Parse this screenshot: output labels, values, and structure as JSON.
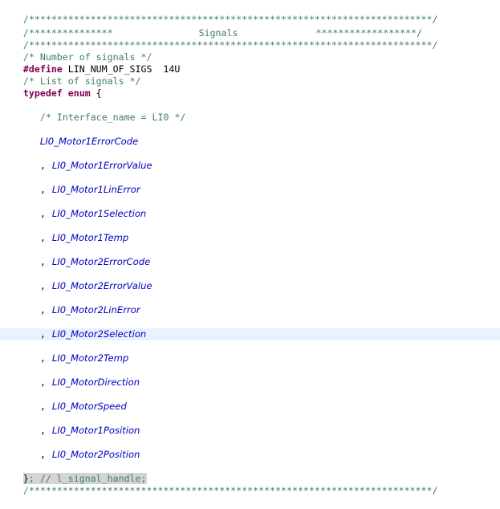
{
  "lines": {
    "banner_top": "/************************************************************************/",
    "banner_mid_left": "/***************",
    "banner_mid_title": "Signals",
    "banner_mid_right": "******************/",
    "banner_bottom": "/************************************************************************/",
    "comment_num": "/* Number of signals */",
    "define_kw": "#define",
    "define_rest": " LIN_NUM_OF_SIGS  14U",
    "comment_list": "/* List of signals */",
    "typedef_kw": "typedef enum",
    "typedef_brace": " {",
    "comment_iface": "/* Interface_name = LI0 */",
    "closing_brace": "}",
    "closing_comment": "; // l_signal_handle;",
    "banner_end": "/************************************************************************/"
  },
  "enum_items": [
    "LI0_Motor1ErrorCode",
    "LI0_Motor1ErrorValue",
    "LI0_Motor1LinError",
    "LI0_Motor1Selection",
    "LI0_Motor1Temp",
    "LI0_Motor2ErrorCode",
    "LI0_Motor2ErrorValue",
    "LI0_Motor2LinError",
    "LI0_Motor2Selection",
    "LI0_Motor2Temp",
    "LI0_MotorDirection",
    "LI0_MotorSpeed",
    "LI0_Motor1Position",
    "LI0_Motor2Position"
  ],
  "separator": ",",
  "colors": {
    "comment": "#3f7f5f",
    "keyword": "#7f0055",
    "enum_constant": "#0000c0",
    "current_line": "#e8f2fe",
    "bracket_highlight": "#d4d4d4"
  }
}
